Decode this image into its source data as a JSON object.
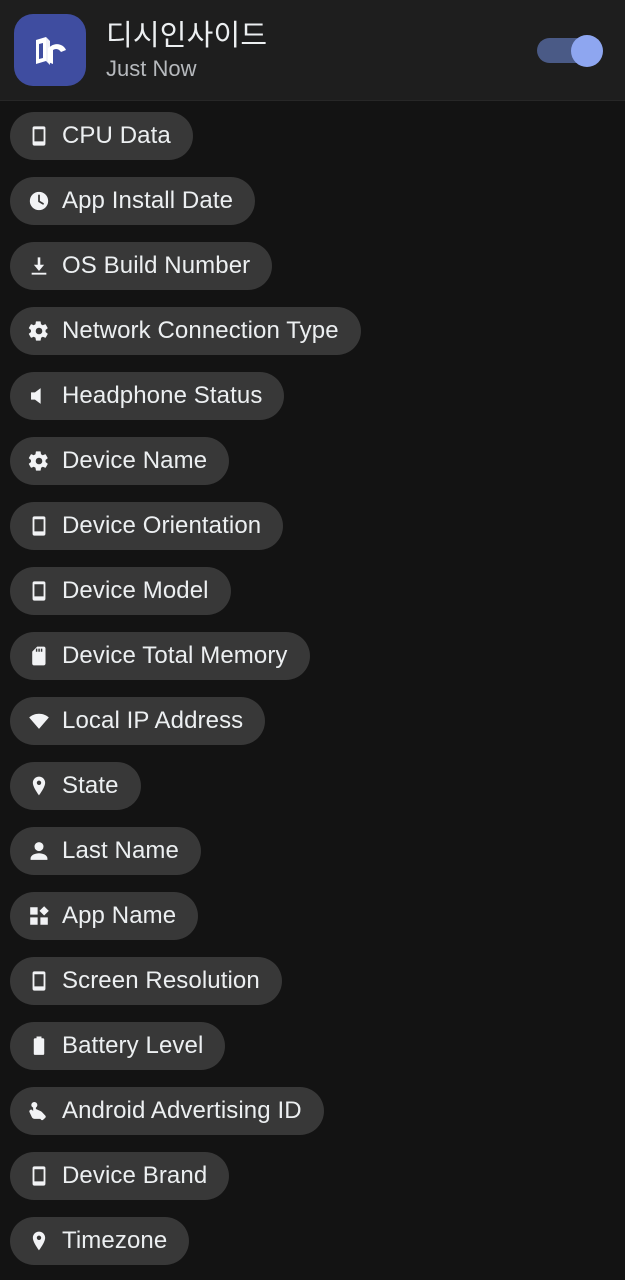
{
  "header": {
    "app_icon_name": "dcinside-app-icon",
    "icon_bg_color": "#3f4da0",
    "title": "디시인사이드",
    "subtitle": "Just Now",
    "toggle": {
      "name": "notification-toggle",
      "state": "on",
      "track_color": "#4a5a86",
      "thumb_color": "#8ea6f0"
    }
  },
  "theme": {
    "page_bg": "#131313",
    "header_bg": "#1e1e1e",
    "chip_bg": "#383838",
    "text_primary": "#eceff1",
    "text_secondary": "#b6b9bd"
  },
  "chips": [
    {
      "label": "CPU Data",
      "icon": "phone-icon"
    },
    {
      "label": "App Install Date",
      "icon": "clock-icon"
    },
    {
      "label": "OS Build Number",
      "icon": "download-icon"
    },
    {
      "label": "Network Connection Type",
      "icon": "gear-icon"
    },
    {
      "label": "Headphone Status",
      "icon": "speaker-icon"
    },
    {
      "label": "Device Name",
      "icon": "gear-icon"
    },
    {
      "label": "Device Orientation",
      "icon": "phone-icon"
    },
    {
      "label": "Device Model",
      "icon": "phone-icon"
    },
    {
      "label": "Device Total Memory",
      "icon": "sdcard-icon"
    },
    {
      "label": "Local IP Address",
      "icon": "wifi-icon"
    },
    {
      "label": "State",
      "icon": "location-pin-icon"
    },
    {
      "label": "Last Name",
      "icon": "person-icon"
    },
    {
      "label": "App Name",
      "icon": "apps-grid-icon"
    },
    {
      "label": "Screen Resolution",
      "icon": "phone-icon"
    },
    {
      "label": "Battery Level",
      "icon": "battery-icon"
    },
    {
      "label": "Android Advertising ID",
      "icon": "touch-icon"
    },
    {
      "label": "Device Brand",
      "icon": "phone-icon"
    },
    {
      "label": "Timezone",
      "icon": "location-pin-icon"
    }
  ]
}
